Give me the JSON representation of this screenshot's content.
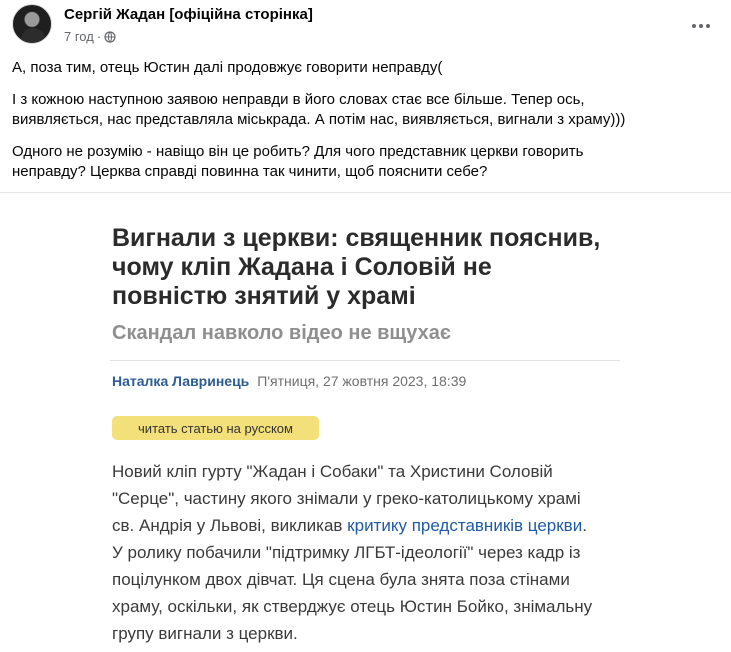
{
  "post": {
    "author": "Сергій Жадан [офіційна сторінка]",
    "time": "7 год",
    "separator": "·",
    "visibility_icon": "globe-icon",
    "more_icon": "more-horizontal-icon",
    "text": {
      "p1": "А, поза тим, отець Юстин далі продовжує говорити неправду(",
      "p2_line1": "І з кожною наступною заявою неправди в його словах стає все більше. Тепер ось,",
      "p2_line2": "виявляється, нас представляла міськрада. А потім нас, виявляється, вигнали з храму)))",
      "p3_line1": "Одного не розумію - навіщо він це робить? Для чого представник церкви говорить",
      "p3_line2": "неправду? Церква справді повинна так чинити, щоб пояснити себе?"
    }
  },
  "article": {
    "title_line1": "Вигнали з церкви: священник пояснив,",
    "title_line2": "чому кліп Жадана і Соловій не",
    "title_line3": "повністю знятий у храмі",
    "subtitle": "Скандал навколо відео не вщухає",
    "author": "Наталка Лавринець",
    "date": "П'ятниця, 27 жовтня 2023, 18:39",
    "lang_button": "читать статью на русском",
    "body": {
      "l1": "Новий кліп гурту \"Жадан і Собаки\" та Христини Соловій",
      "l2": "\"Серце\", частину якого знімали у греко-католицькому храмі",
      "l3_pre": "св. Андрія у Львові, викликав ",
      "l3_link": "критику представників церкви",
      "l3_post": ".",
      "l4": "У ролику побачили \"підтримку ЛГБТ-ідеології\" через кадр із",
      "l5": "поцілунком двох дівчат. Ця сцена була знята поза стінами",
      "l6": "храму, оскільки, як стверджує отець Юстин Бойко, знімальну",
      "l7": "групу вигнали з церкви."
    }
  },
  "colors": {
    "link": "#1f5aa6",
    "byline_author": "#2d5c93",
    "lang_button_bg": "#f3e07a",
    "subtitle": "#8f8f8f",
    "meta": "#65676b"
  }
}
